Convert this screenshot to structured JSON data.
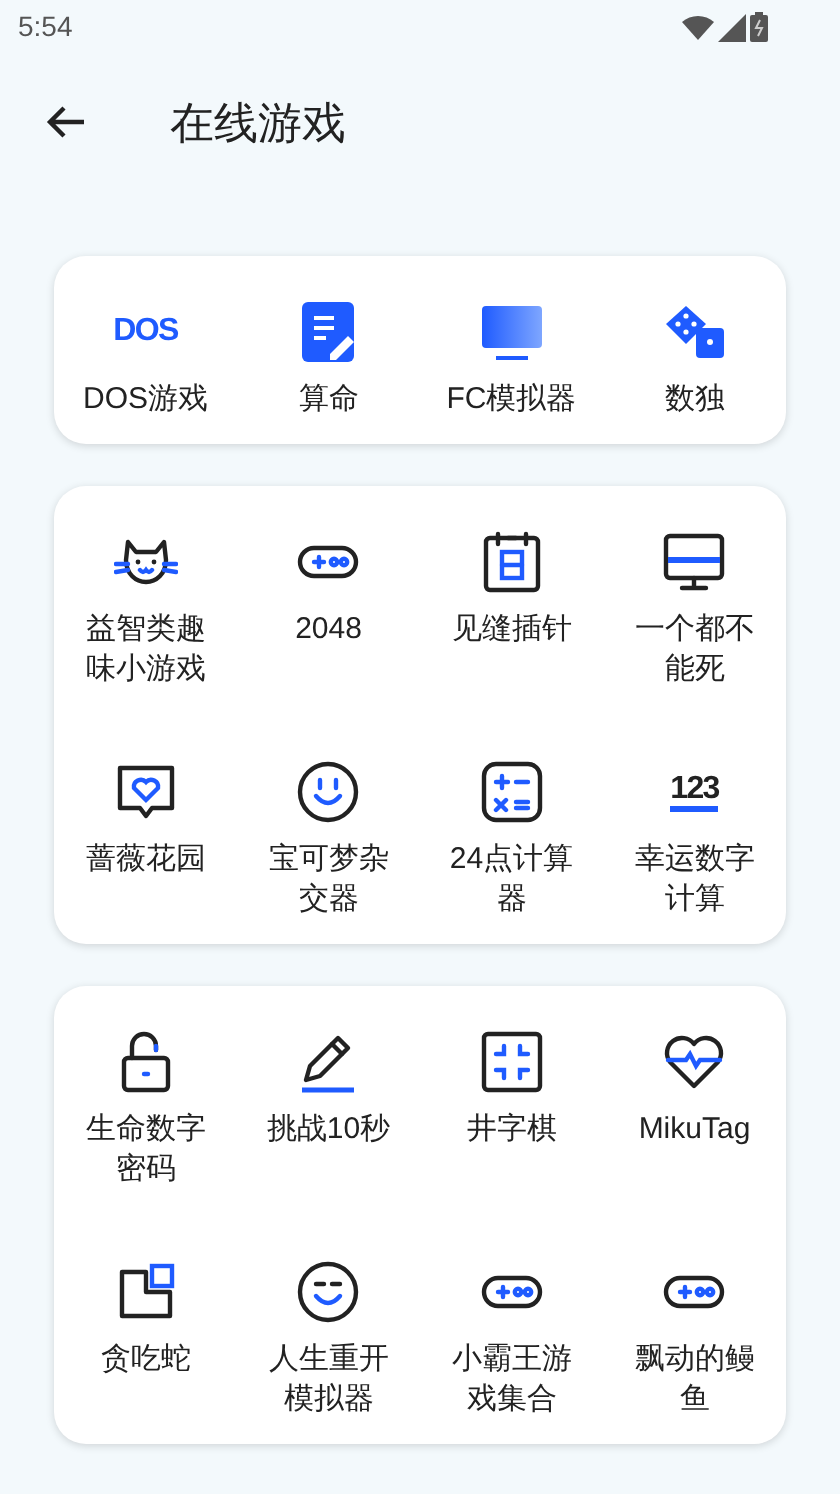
{
  "status_bar": {
    "time": "5:54"
  },
  "header": {
    "title": "在线游戏"
  },
  "sections": [
    {
      "items": [
        {
          "label": "DOS游戏",
          "icon_text": "DOS"
        },
        {
          "label": "算命"
        },
        {
          "label": "FC模拟器"
        },
        {
          "label": "数独"
        }
      ]
    },
    {
      "items": [
        {
          "label": "益智类趣味小游戏"
        },
        {
          "label": "2048"
        },
        {
          "label": "见缝插针"
        },
        {
          "label": "一个都不能死"
        },
        {
          "label": "蔷薇花园"
        },
        {
          "label": "宝可梦杂交器"
        },
        {
          "label": "24点计算器"
        },
        {
          "label": "幸运数字计算",
          "icon_text": "123"
        }
      ]
    },
    {
      "items": [
        {
          "label": "生命数字密码"
        },
        {
          "label": "挑战10秒"
        },
        {
          "label": "井字棋"
        },
        {
          "label": "MikuTag"
        },
        {
          "label": "贪吃蛇"
        },
        {
          "label": "人生重开模拟器"
        },
        {
          "label": "小霸王游戏集合"
        },
        {
          "label": "飘动的鳗鱼"
        }
      ]
    }
  ]
}
